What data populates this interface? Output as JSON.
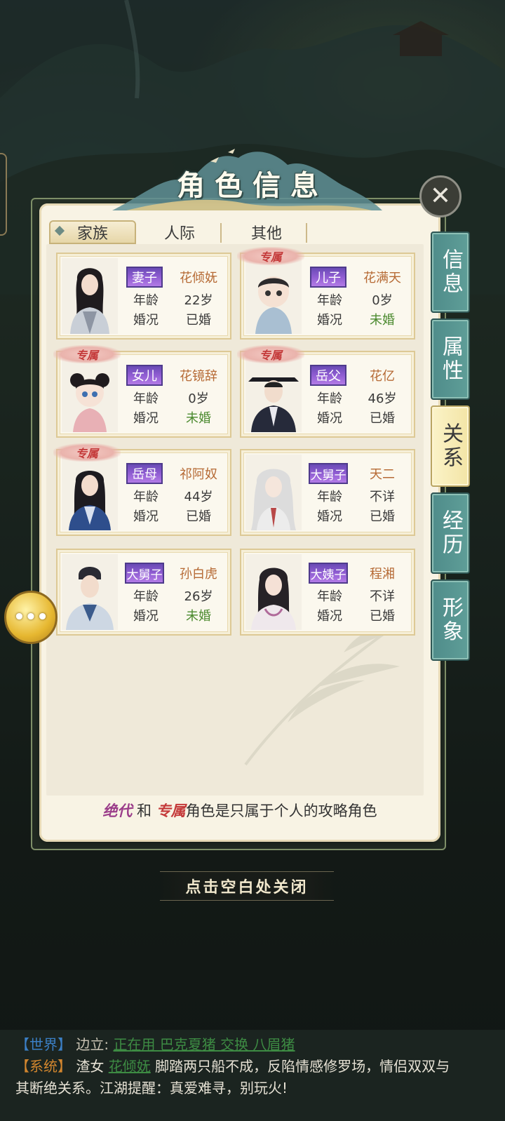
{
  "dialog": {
    "title": "角色信息",
    "close_icon": "close-x-icon",
    "close_hint": "点击空白处关闭"
  },
  "top_tabs": [
    {
      "label": "家族",
      "active": true
    },
    {
      "label": "人际",
      "active": false
    },
    {
      "label": "其他",
      "active": false
    }
  ],
  "side_tabs": [
    {
      "label": "信息",
      "active": false
    },
    {
      "label": "属性",
      "active": false
    },
    {
      "label": "关系",
      "active": true
    },
    {
      "label": "经历",
      "active": false
    },
    {
      "label": "形象",
      "active": false
    }
  ],
  "labels": {
    "age": "年龄",
    "marriage": "婚况",
    "exclusive": "专属"
  },
  "characters": [
    {
      "role": "妻子",
      "name": "花倾妩",
      "age": "22岁",
      "marital": "已婚",
      "exclusive": false
    },
    {
      "role": "儿子",
      "name": "花满天",
      "age": "0岁",
      "marital": "未婚",
      "exclusive": true
    },
    {
      "role": "女儿",
      "name": "花镜辞",
      "age": "0岁",
      "marital": "未婚",
      "exclusive": true
    },
    {
      "role": "岳父",
      "name": "花亿",
      "age": "46岁",
      "marital": "已婚",
      "exclusive": true
    },
    {
      "role": "岳母",
      "name": "祁阿奴",
      "age": "44岁",
      "marital": "已婚",
      "exclusive": true
    },
    {
      "role": "大舅子",
      "name": "天二",
      "age": "不详",
      "marital": "已婚",
      "exclusive": false
    },
    {
      "role": "大舅子",
      "name": "孙白虎",
      "age": "26岁",
      "marital": "未婚",
      "exclusive": false
    },
    {
      "role": "大姨子",
      "name": "程湘",
      "age": "不详",
      "marital": "已婚",
      "exclusive": false
    }
  ],
  "footer_note": {
    "tag1": "绝代",
    "connector": "和",
    "tag2": "专属",
    "rest": "角色是只属于个人的攻略角色"
  },
  "chat_bubble_icon": "speech-bubble-icon",
  "chat_log": {
    "line1": {
      "channel": "【世界】",
      "speaker": "边立:",
      "message": "正在用 巴克夏猪 交换 八眉猪"
    },
    "line2": {
      "channel": "【系统】",
      "prefix": "渣女",
      "link_name": "花倾妩",
      "text": "脚踏两只船不成，反陷情感修罗场，情侣双双与"
    },
    "line3": "其断绝关系。江湖提醒：真爱难寻，别玩火!"
  },
  "colors": {
    "panel_bg": "#f8f3e4",
    "side_tab_teal": "#5f9e98",
    "role_badge_purple": "#8d5bd0",
    "name_orange": "#b66a35",
    "unmarried_green": "#4b8a2f",
    "exclusive_red": "#c43a3a"
  }
}
